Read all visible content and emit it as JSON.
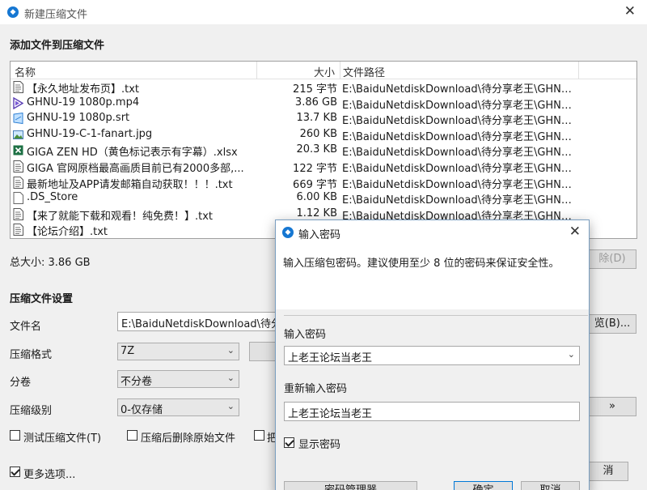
{
  "window": {
    "title": "新建压缩文件",
    "app_icon": "bandizip-icon"
  },
  "files_section": {
    "heading": "添加文件到压缩文件",
    "columns": {
      "name": "名称",
      "size": "大小",
      "path": "文件路径"
    },
    "files": [
      {
        "name": "【永久地址发布页】.txt",
        "size": "215 字节",
        "path": "E:\\BaiduNetdiskDownload\\待分享老王\\GHNU...",
        "icon": "text-file-icon"
      },
      {
        "name": "GHNU-19 1080p.mp4",
        "size": "3.86 GB",
        "path": "E:\\BaiduNetdiskDownload\\待分享老王\\GHNU...",
        "icon": "video-file-icon"
      },
      {
        "name": "GHNU-19 1080p.srt",
        "size": "13.7 KB",
        "path": "E:\\BaiduNetdiskDownload\\待分享老王\\GHNU...",
        "icon": "subtitle-file-icon"
      },
      {
        "name": "GHNU-19-C-1-fanart.jpg",
        "size": "260 KB",
        "path": "E:\\BaiduNetdiskDownload\\待分享老王\\GHNU...",
        "icon": "image-file-icon"
      },
      {
        "name": "GIGA ZEN HD（黄色标记表示有字幕）.xlsx",
        "size": "20.3 KB",
        "path": "E:\\BaiduNetdiskDownload\\待分享老王\\GHNU...",
        "icon": "excel-file-icon"
      },
      {
        "name": "GIGA 官网原档最高画质目前已有2000多部,...",
        "size": "122 字节",
        "path": "E:\\BaiduNetdiskDownload\\待分享老王\\GHNU...",
        "icon": "text-file-icon"
      },
      {
        "name": "最新地址及APP请发邮箱自动获取！！！.txt",
        "size": "669 字节",
        "path": "E:\\BaiduNetdiskDownload\\待分享老王\\GHNU...",
        "icon": "text-file-icon"
      },
      {
        "name": ".DS_Store",
        "size": "6.00 KB",
        "path": "E:\\BaiduNetdiskDownload\\待分享老王\\GHNU...",
        "icon": "blank-file-icon"
      },
      {
        "name": "【来了就能下载和观看！纯免费！】.txt",
        "size": "1.12 KB",
        "path": "E:\\BaiduNetdiskDownload\\待分享老王\\GHNU...",
        "icon": "text-file-icon"
      },
      {
        "name": "【论坛介绍】.txt",
        "size": "",
        "path": "",
        "icon": "text-file-icon"
      }
    ],
    "total_label": "总大小: 3.86 GB",
    "delete_button": "除(D)"
  },
  "settings": {
    "heading": "压缩文件设置",
    "filename_label": "文件名",
    "filename_value": "E:\\BaiduNetdiskDownload\\待分",
    "browse_button": "览(B)...",
    "format_label": "压缩格式",
    "format_value": "7Z",
    "split_label": "分卷",
    "split_value": "不分卷",
    "level_label": "压缩级别",
    "level_value": "0-仅存储",
    "more_arrow": "»",
    "test_label": "测试压缩文件(T)",
    "delete_after_label": "压缩后删除原始文件",
    "third_option": "把",
    "more_options_label": "更多选项...",
    "cancel_button": "消"
  },
  "password_dialog": {
    "title": "输入密码",
    "hint": "输入压缩包密码。建议使用至少 8 位的密码来保证安全性。",
    "password_label": "输入密码",
    "password_value": "上老王论坛当老王",
    "confirm_label": "重新输入密码",
    "confirm_value": "上老王论坛当老王",
    "show_password_label": "显示密码",
    "manager_button": "密码管理器",
    "ok_button": "确定",
    "cancel_button": "取消"
  }
}
